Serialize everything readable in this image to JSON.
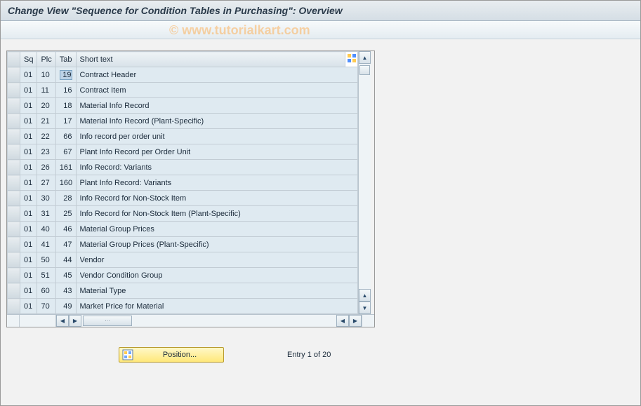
{
  "title": "Change View \"Sequence for Condition Tables in Purchasing\": Overview",
  "watermark": "© www.tutorialkart.com",
  "columns": {
    "sel": "",
    "sq": "Sq",
    "plc": "Plc",
    "tab": "Tab",
    "short": "Short text"
  },
  "rows": [
    {
      "sq": "01",
      "plc": "10",
      "tab": "19",
      "text": "Contract Header"
    },
    {
      "sq": "01",
      "plc": "11",
      "tab": "16",
      "text": "Contract Item"
    },
    {
      "sq": "01",
      "plc": "20",
      "tab": "18",
      "text": "Material Info Record"
    },
    {
      "sq": "01",
      "plc": "21",
      "tab": "17",
      "text": "Material Info Record (Plant-Specific)"
    },
    {
      "sq": "01",
      "plc": "22",
      "tab": "66",
      "text": "Info record per order unit"
    },
    {
      "sq": "01",
      "plc": "23",
      "tab": "67",
      "text": "Plant Info Record per Order Unit"
    },
    {
      "sq": "01",
      "plc": "26",
      "tab": "161",
      "text": "Info Record: Variants"
    },
    {
      "sq": "01",
      "plc": "27",
      "tab": "160",
      "text": "Plant Info Record: Variants"
    },
    {
      "sq": "01",
      "plc": "30",
      "tab": "28",
      "text": "Info Record for Non-Stock Item"
    },
    {
      "sq": "01",
      "plc": "31",
      "tab": "25",
      "text": "Info Record for Non-Stock Item (Plant-Specific)"
    },
    {
      "sq": "01",
      "plc": "40",
      "tab": "46",
      "text": "Material Group Prices"
    },
    {
      "sq": "01",
      "plc": "41",
      "tab": "47",
      "text": "Material Group Prices (Plant-Specific)"
    },
    {
      "sq": "01",
      "plc": "50",
      "tab": "44",
      "text": "Vendor"
    },
    {
      "sq": "01",
      "plc": "51",
      "tab": "45",
      "text": "Vendor Condition Group"
    },
    {
      "sq": "01",
      "plc": "60",
      "tab": "43",
      "text": "Material Type"
    },
    {
      "sq": "01",
      "plc": "70",
      "tab": "49",
      "text": "Market Price for Material"
    }
  ],
  "position_button": "Position...",
  "entry_text": "Entry 1 of 20"
}
